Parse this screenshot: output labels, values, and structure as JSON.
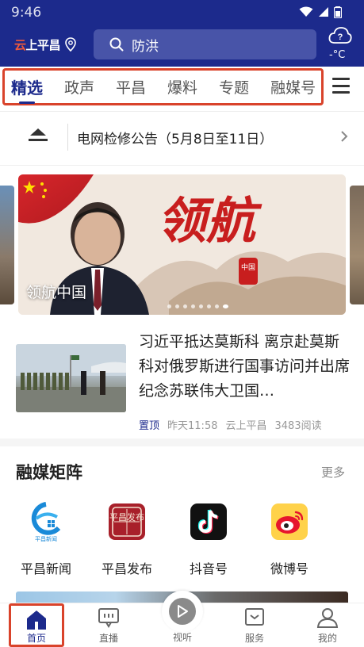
{
  "status_bar": {
    "time": "9:46"
  },
  "header": {
    "logo_text_prefix": "云",
    "logo_text": "上平昌",
    "search_placeholder": "防洪",
    "weather_temp": "-°C"
  },
  "tabs": [
    {
      "label": "精选",
      "active": true
    },
    {
      "label": "政声"
    },
    {
      "label": "平昌"
    },
    {
      "label": "爆料"
    },
    {
      "label": "专题"
    },
    {
      "label": "融媒号"
    }
  ],
  "notice": {
    "text": "电网检修公告（5月8日至11日）"
  },
  "banner": {
    "caption": "领航中国",
    "headline_art": "领航",
    "seal_text": "中国"
  },
  "news": {
    "title": "习近平抵达莫斯科 离京赴莫斯科对俄罗斯进行国事访问并出席纪念苏联伟大卫国…",
    "pin": "置顶",
    "time": "昨天11:58",
    "source": "云上平昌",
    "reads": "3483阅读"
  },
  "matrix": {
    "title": "融媒矩阵",
    "more": "更多",
    "items": [
      {
        "label": "平昌新闻",
        "icon_text": "平昌新闻"
      },
      {
        "label": "平昌发布",
        "icon_text": "平昌发布"
      },
      {
        "label": "抖音号"
      },
      {
        "label": "微博号"
      }
    ]
  },
  "bottom_nav": {
    "home": "首页",
    "live": "直播",
    "watch": "视听",
    "service": "服务",
    "mine": "我的"
  },
  "colors": {
    "brand": "#1c2a8c",
    "highlight": "#d9432b"
  }
}
